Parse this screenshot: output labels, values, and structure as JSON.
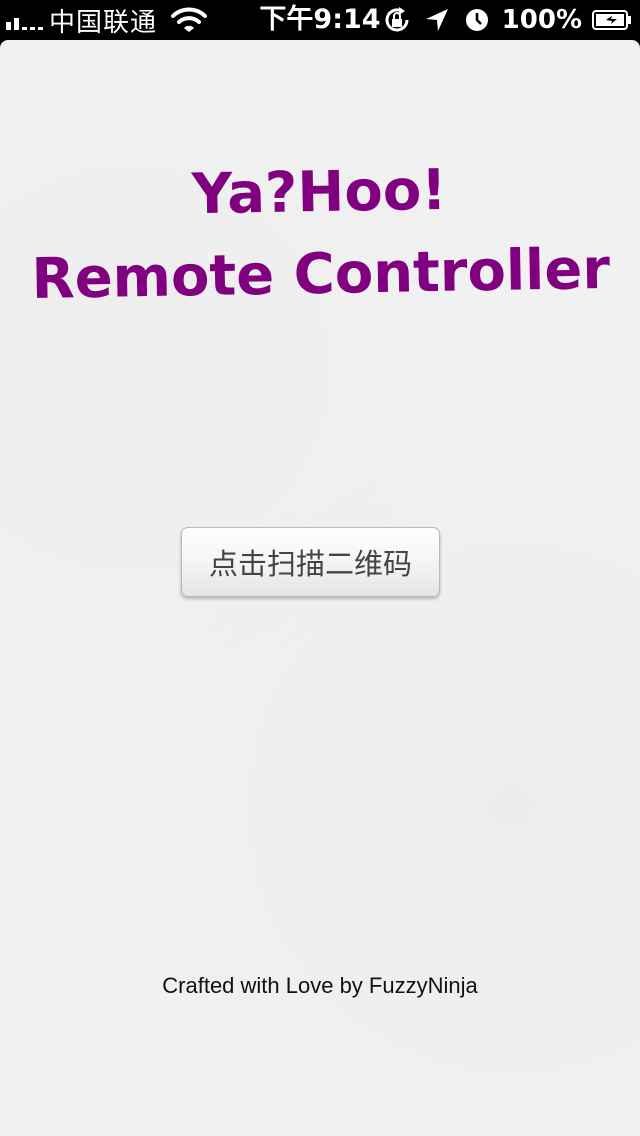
{
  "status_bar": {
    "carrier": "中国联通",
    "time": "下午9:14",
    "battery_percent": "100%",
    "signal_bars": 2,
    "icons": [
      "signal-icon",
      "wifi-icon",
      "rotation-lock-icon",
      "location-icon",
      "alarm-icon",
      "battery-icon"
    ]
  },
  "main": {
    "title_line1": "Ya?Hoo!",
    "title_line2": "Remote Controller",
    "scan_button_label": "点击扫描二维码",
    "footer_text": "Crafted with Love by FuzzyNinja"
  },
  "colors": {
    "title": "#800080",
    "background": "#f1f1f1",
    "status_bar": "#000000"
  }
}
